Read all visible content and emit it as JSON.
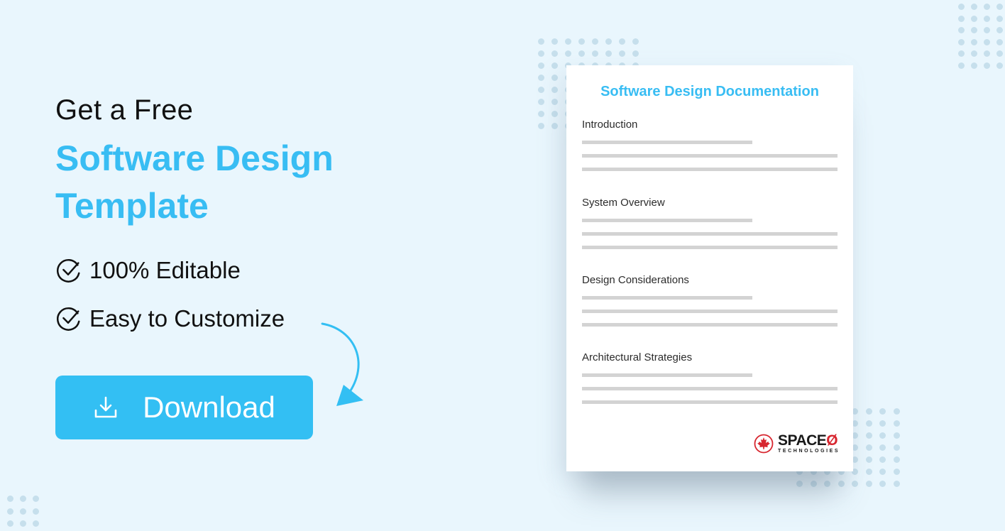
{
  "hero": {
    "eyebrow": "Get a Free",
    "title_line1": "Software Design",
    "title_line2": "Template"
  },
  "features": [
    {
      "icon": "check-circle-icon",
      "label": "100% Editable"
    },
    {
      "icon": "check-circle-icon",
      "label": "Easy to Customize"
    }
  ],
  "cta": {
    "icon": "download-icon",
    "label": "Download"
  },
  "document": {
    "title": "Software Design Documentation",
    "sections": [
      {
        "heading": "Introduction"
      },
      {
        "heading": "System Overview"
      },
      {
        "heading": "Design Considerations"
      },
      {
        "heading": "Architectural Strategies"
      }
    ],
    "logo": {
      "name_main": "SPACE",
      "name_accent": "Ø",
      "subtitle": "TECHNOLOGIES"
    }
  },
  "colors": {
    "background": "#e9f6fd",
    "accent": "#38bdf3",
    "button": "#33bff3",
    "logo_red": "#d7262f",
    "placeholder_bar": "#d3d3d3"
  }
}
